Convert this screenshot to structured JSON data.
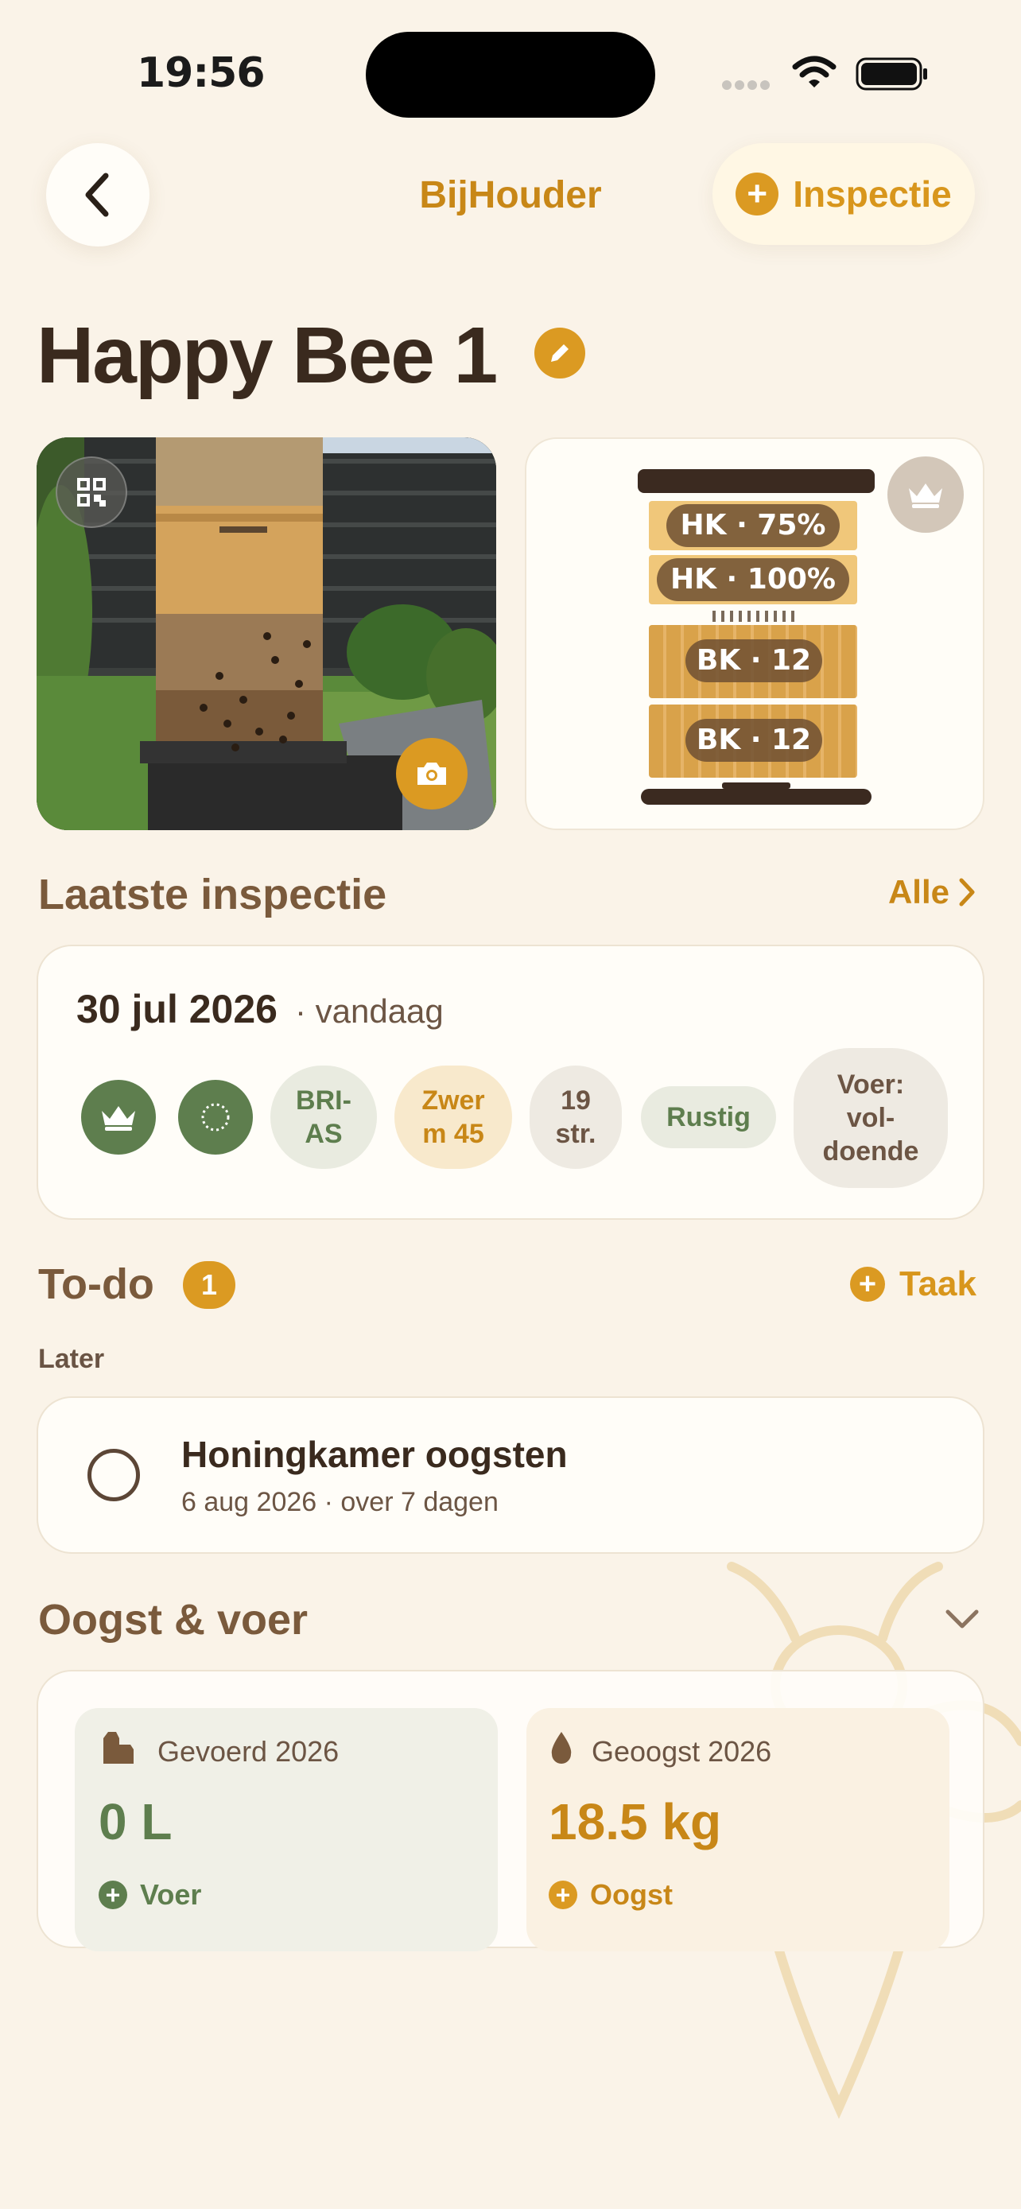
{
  "status_bar": {
    "time": "19:56"
  },
  "nav": {
    "title": "BijHouder",
    "inspection_button": "Inspectie"
  },
  "hive": {
    "name": "Happy Bee 1"
  },
  "diagram": {
    "honey_supers": [
      "HK · 75%",
      "HK · 100%"
    ],
    "brood_boxes": [
      "BK · 12",
      "BK · 12"
    ]
  },
  "last_inspection": {
    "section_title": "Laatste inspectie",
    "all_link": "Alle",
    "date": "30 jul 2026",
    "relative": "· vandaag",
    "chips": {
      "breed": "BRI-\nAS",
      "swarm": "Zwer\nm 45",
      "frames": "19\nstr.",
      "temper": "Rustig",
      "food": "Voer:\nvol-\ndoende"
    }
  },
  "todo": {
    "title": "To-do",
    "count": "1",
    "add_label": "Taak",
    "group": "Later",
    "items": [
      {
        "title": "Honingkamer oogsten",
        "subtitle": "6 aug 2026 · over 7 dagen"
      }
    ]
  },
  "harvest": {
    "title": "Oogst & voer",
    "fed": {
      "label": "Gevoerd 2026",
      "value": "0 L",
      "action": "Voer",
      "color": "#5E7E4E"
    },
    "harvested": {
      "label": "Geoogst 2026",
      "value": "18.5 kg",
      "action": "Oogst",
      "color": "#C88717"
    }
  }
}
